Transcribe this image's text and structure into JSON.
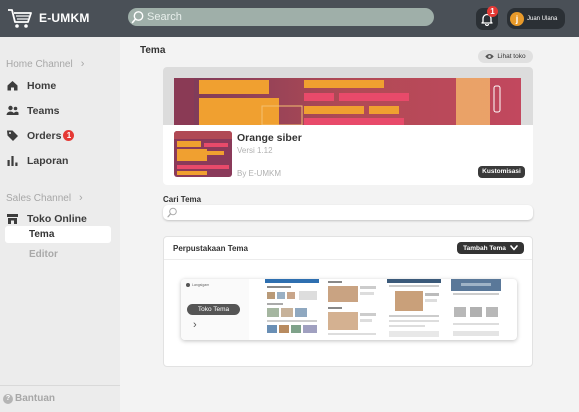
{
  "app": {
    "name": "E-UMKM"
  },
  "topbar": {
    "search_placeholder": "Search",
    "notification_count": "1",
    "user": {
      "initial": "j",
      "name": "Juan Ulana"
    }
  },
  "sidebar": {
    "home_channel_title": "Home Channel",
    "home_items": [
      {
        "label": "Home"
      },
      {
        "label": "Teams"
      },
      {
        "label": "Orders",
        "badge": "1"
      },
      {
        "label": "Laporan"
      }
    ],
    "sales_channel_title": "Sales Channel",
    "sales_item": {
      "label": "Toko Online"
    },
    "sub_items": [
      {
        "label": "Tema",
        "active": true
      },
      {
        "label": "Editor",
        "active": false
      }
    ],
    "help_label": "Bantuan"
  },
  "main": {
    "page_title": "Tema",
    "view_store_label": "Lihat toko",
    "current_theme": {
      "name": "Orange siber",
      "version": "Versi 1.12",
      "author": "By E-UMKM",
      "customize_label": "Kustomisasi"
    },
    "search": {
      "label": "Cari Tema",
      "placeholder": ""
    },
    "library": {
      "title": "Perpustakaan Tema",
      "add_label": "Tambah Tema",
      "preview": {
        "logo_text": "Langsigam",
        "button_label": "Toko Tema"
      }
    }
  },
  "colors": {
    "topbar": "#4a5057",
    "search_bg": "#9fafa9",
    "badge": "#e53935",
    "theme_orange": "#f0a030",
    "theme_magenta": "#e84a6a",
    "theme_purple": "#7a3a5a"
  }
}
